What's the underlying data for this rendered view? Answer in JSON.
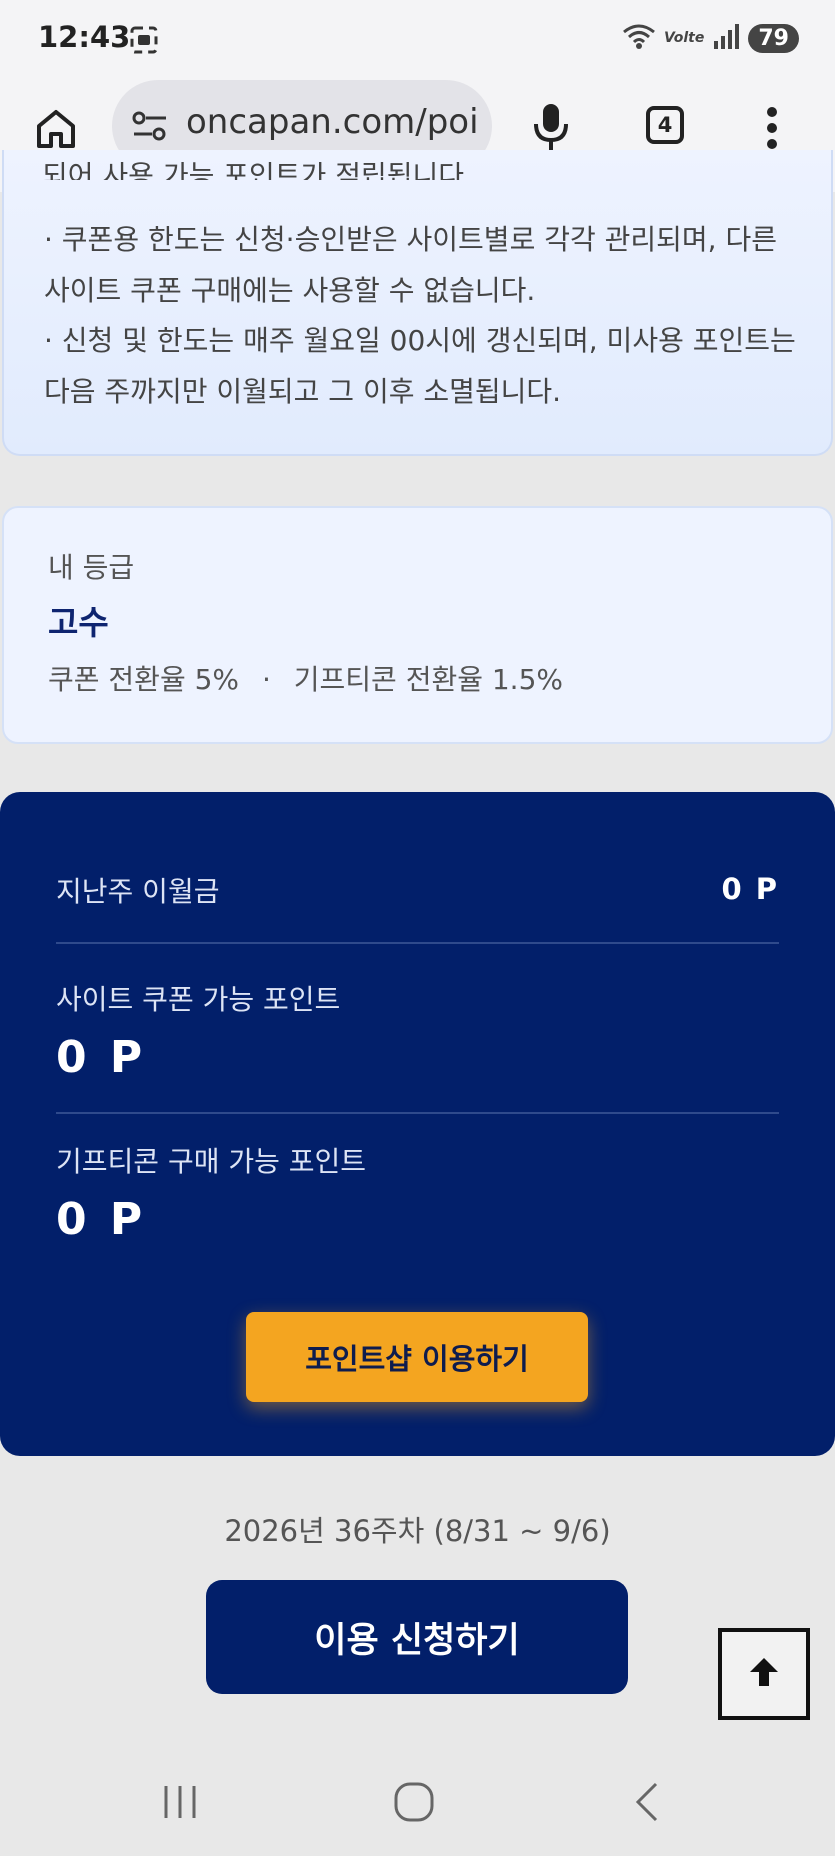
{
  "status_bar": {
    "time": "12:43",
    "network": "Volte",
    "battery": "79",
    "icons": [
      "screenshot-icon",
      "wifi-icon",
      "signal-icon"
    ]
  },
  "browser": {
    "url": "oncapan.com/poi",
    "tab_count": "4",
    "icons": [
      "home-icon",
      "site-settings-icon",
      "mic-icon",
      "more-icon"
    ]
  },
  "notice": {
    "partial_line": "되어 사용 가능 포인트가 적립됩니다.",
    "lines": [
      "· 쿠폰용 한도는 신청·승인받은 사이트별로 각각 관리되며, 다른 사이트 쿠폰 구매에는 사용할 수 없습니다.",
      "· 신청 및 한도는 매주 월요일 00시에 갱신되며, 미사용 포인트는 다음 주까지만 이월되고 그 이후 소멸됩니다."
    ]
  },
  "grade": {
    "label": "내 등급",
    "value": "고수",
    "coupon_rate": "쿠폰 전환율 5%",
    "separator": "·",
    "gifticon_rate": "기프티콘 전환율 1.5%"
  },
  "points": {
    "carryover_label": "지난주 이월금",
    "carryover_value": "0 P",
    "site_coupon_label": "사이트 쿠폰 가능 포인트",
    "site_coupon_value": "0 P",
    "gifticon_label": "기프티콘 구매 가능 포인트",
    "gifticon_value": "0 P",
    "shop_button": "포인트샵 이용하기"
  },
  "week_info": "2026년 36주차 (8/31 ~ 9/6)",
  "apply_button": "이용 신청하기",
  "colors": {
    "navy": "#021f6a",
    "accent": "#f4a520",
    "card_bg": "#eef3ff"
  },
  "nav_icons": [
    "recent-apps-icon",
    "home-circle-icon",
    "back-icon",
    "arrow-up-icon"
  ]
}
